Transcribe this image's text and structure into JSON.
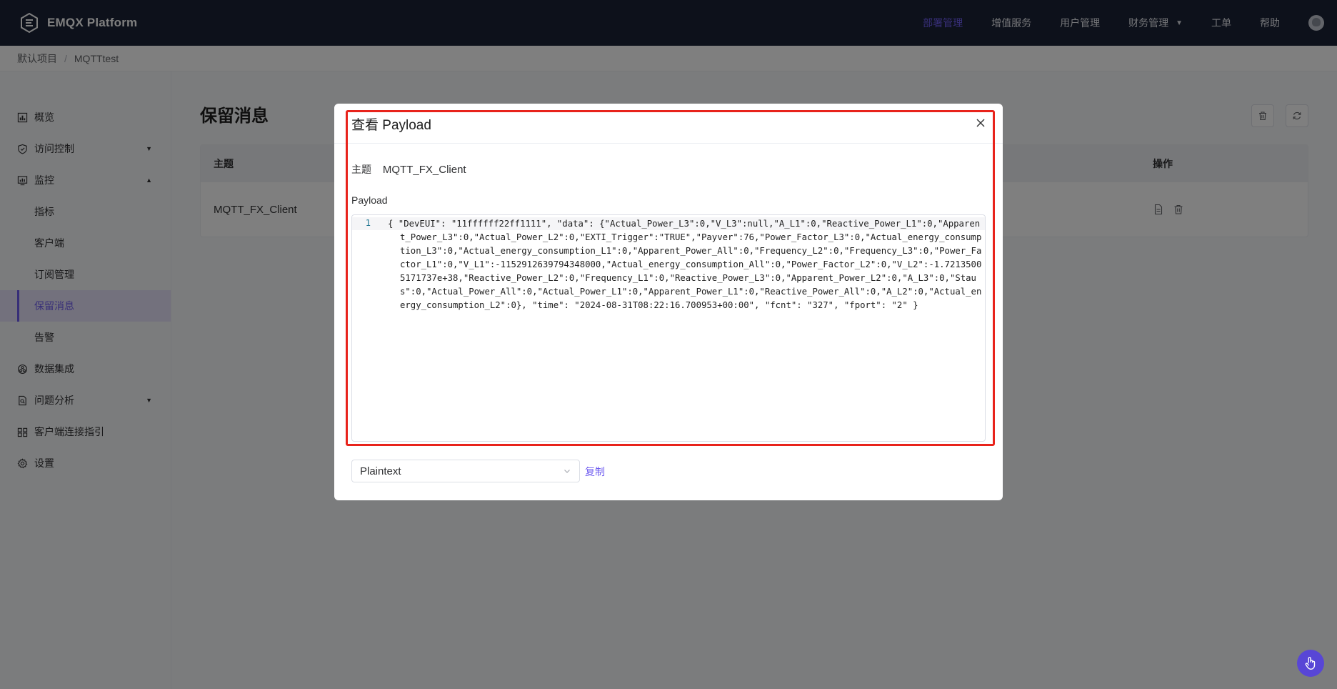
{
  "brand": {
    "name": "EMQX Platform"
  },
  "topnav": {
    "items": [
      {
        "label": "部署管理",
        "active": true
      },
      {
        "label": "增值服务"
      },
      {
        "label": "用户管理"
      },
      {
        "label": "财务管理",
        "has_dropdown": true
      },
      {
        "label": "工单"
      },
      {
        "label": "帮助"
      }
    ],
    "avatar_icon": "user-avatar-icon"
  },
  "breadcrumb": {
    "items": [
      "默认项目",
      "MQTTtest"
    ],
    "separator": "/"
  },
  "sidebar": {
    "items": [
      {
        "label": "概览",
        "icon": "overview-icon"
      },
      {
        "label": "访问控制",
        "icon": "shield-icon",
        "expandable": true,
        "expanded": false
      },
      {
        "label": "监控",
        "icon": "monitor-icon",
        "expandable": true,
        "expanded": true
      },
      {
        "label": "指标",
        "sub": true
      },
      {
        "label": "客户端",
        "sub": true
      },
      {
        "label": "订阅管理",
        "sub": true
      },
      {
        "label": "保留消息",
        "sub": true,
        "active": true
      },
      {
        "label": "告警",
        "sub": true
      },
      {
        "label": "数据集成",
        "icon": "data-integration-icon"
      },
      {
        "label": "问题分析",
        "icon": "analysis-icon",
        "expandable": true,
        "expanded": false
      },
      {
        "label": "客户端连接指引",
        "icon": "connect-guide-icon"
      },
      {
        "label": "设置",
        "icon": "gear-icon"
      }
    ]
  },
  "main": {
    "title": "保留消息",
    "toolbar": {
      "delete_icon": "trash-icon",
      "refresh_icon": "refresh-icon"
    },
    "table": {
      "headers": {
        "topic": "主题",
        "ops": "操作"
      },
      "rows": [
        {
          "topic": "MQTT_FX_Client"
        }
      ]
    }
  },
  "modal": {
    "title": "查看 Payload",
    "topic_label": "主题",
    "topic_value": "MQTT_FX_Client",
    "payload_label": "Payload",
    "line_number": "1",
    "payload": "{ \"DevEUI\": \"11ffffff22ff1111\", \"data\": {\"Actual_Power_L3\":0,\"V_L3\":null,\"A_L1\":0,\"Reactive_Power_L1\":0,\"Apparent_Power_L3\":0,\"Actual_Power_L2\":0,\"EXTI_Trigger\":\"TRUE\",\"Payver\":76,\"Power_Factor_L3\":0,\"Actual_energy_consumption_L3\":0,\"Actual_energy_consumption_L1\":0,\"Apparent_Power_All\":0,\"Frequency_L2\":0,\"Frequency_L3\":0,\"Power_Factor_L1\":0,\"V_L1\":-1152912639794348000,\"Actual_energy_consumption_All\":0,\"Power_Factor_L2\":0,\"V_L2\":-1.72135005171737e+38,\"Reactive_Power_L2\":0,\"Frequency_L1\":0,\"Reactive_Power_L3\":0,\"Apparent_Power_L2\":0,\"A_L3\":0,\"Staus\":0,\"Actual_Power_All\":0,\"Actual_Power_L1\":0,\"Apparent_Power_L1\":0,\"Reactive_Power_All\":0,\"A_L2\":0,\"Actual_energy_consumption_L2\":0}, \"time\": \"2024-08-31T08:22:16.700953+00:00\", \"fcnt\": \"327\", \"fport\": \"2\" }",
    "format_selected": "Plaintext",
    "copy_label": "复制"
  },
  "colors": {
    "accent": "#6f5cf0",
    "topbar": "#1b2336",
    "highlight": "#e8231b"
  }
}
